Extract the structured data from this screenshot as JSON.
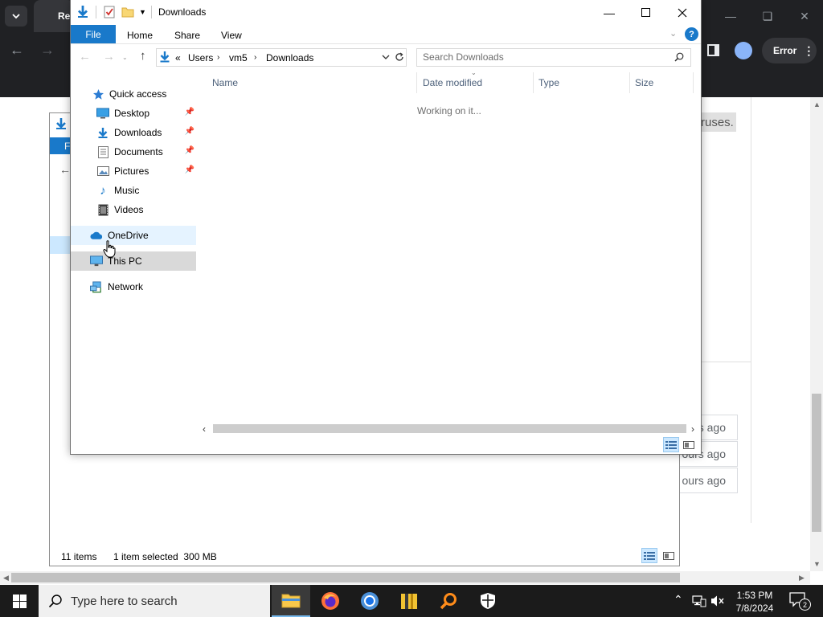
{
  "browser": {
    "tab_title": "Re",
    "profile_status": "Error",
    "page": {
      "highlight_text": "ruses.",
      "card_times": [
        "s ago",
        "ours ago",
        "ours ago"
      ]
    }
  },
  "bg_explorer": {
    "ribbon_first": "F",
    "status_items": "11 items",
    "status_selected": "1 item selected  300 MB"
  },
  "explorer": {
    "title": "Downloads",
    "ribbon_tabs": {
      "file": "File",
      "home": "Home",
      "share": "Share",
      "view": "View"
    },
    "help": "?",
    "address": {
      "overflow": "«",
      "crumbs": [
        "Users",
        "vm5",
        "Downloads"
      ]
    },
    "search_placeholder": "Search Downloads",
    "nav": {
      "quick_access": "Quick access",
      "desktop": "Desktop",
      "downloads": "Downloads",
      "documents": "Documents",
      "pictures": "Pictures",
      "music": "Music",
      "videos": "Videos",
      "onedrive": "OneDrive",
      "this_pc": "This PC",
      "network": "Network"
    },
    "columns": {
      "name": "Name",
      "date_modified": "Date modified",
      "type": "Type",
      "size": "Size"
    },
    "status_message": "Working on it..."
  },
  "taskbar": {
    "search_placeholder": "Type here to search",
    "time": "1:53 PM",
    "date": "7/8/2024",
    "notification_count": "2",
    "apps": [
      "file-explorer",
      "firefox",
      "chrome",
      "winrar",
      "search-tool",
      "security"
    ]
  },
  "colors": {
    "accent_blue": "#1979ca",
    "selection_blue": "#cce8ff",
    "hover_blue": "#e5f3ff",
    "chrome_dark": "#202124",
    "taskbar": "#1b1b1b"
  }
}
